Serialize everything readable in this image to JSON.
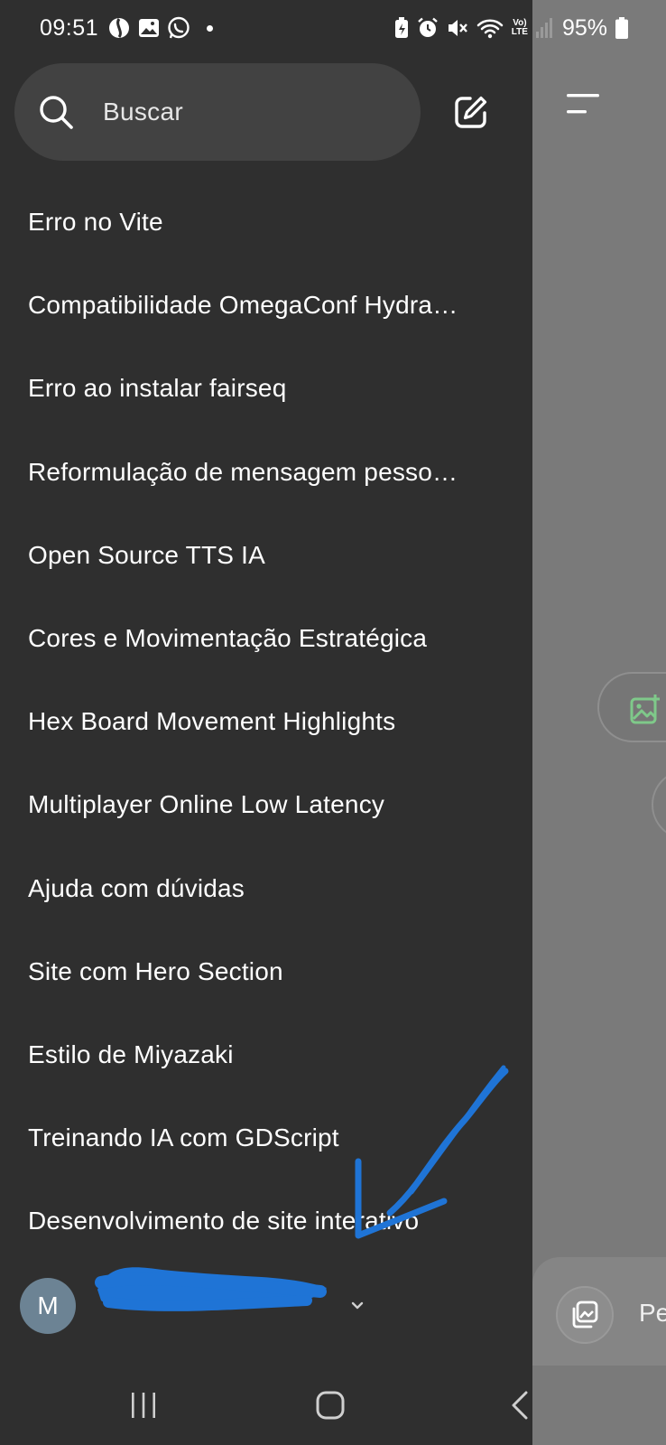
{
  "status_bar": {
    "time": "09:51",
    "battery_percent": "95%",
    "network_top": "Vo)",
    "network_bottom": "LTE"
  },
  "drawer": {
    "search_label": "Buscar",
    "chats": [
      "Erro no Vite",
      "Compatibilidade OmegaConf Hydra…",
      "Erro ao instalar fairseq",
      "Reformulação de mensagem pesso…",
      "Open Source TTS IA",
      "Cores e Movimentação Estratégica",
      "Hex Board Movement Highlights",
      "Multiplayer Online Low Latency",
      "Ajuda com dúvidas",
      "Site com Hero Section",
      "Estilo de Miyazaki",
      "Treinando IA com GDScript",
      "Desenvolvimento de site interativo"
    ],
    "account": {
      "avatar_initial": "M"
    }
  },
  "main": {
    "composer_placeholder": "Pe"
  },
  "colors": {
    "drawer_bg": "#2f2f2f",
    "search_bg": "#424242",
    "dim_overlay": "#7a7a7a",
    "avatar_bg": "#6c8394",
    "annotation_blue": "#1f74d6",
    "image_icon_green": "#7fc98a"
  },
  "icons": {
    "search": "search-icon",
    "new_chat": "edit-square-icon",
    "menu": "menu-lines-icon",
    "image_add": "image-plus-icon",
    "attach": "gallery-icon",
    "chevron": "chevron-down-icon"
  }
}
